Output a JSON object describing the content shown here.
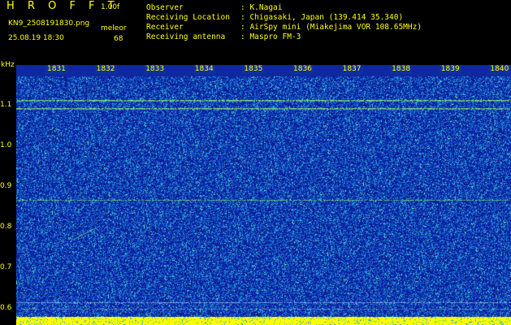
{
  "header": {
    "app_title": "H R O F F T",
    "version": "1.00f",
    "filename": "KN9_2508191830.png",
    "datetime": "25.08.19 18:30",
    "meleor_label": "meleor",
    "meleor_value": "68"
  },
  "info": {
    "labels": [
      "Observer",
      "Receiving Location",
      "Receiver",
      "Receiving antenna"
    ],
    "values": [
      ": K.Nagai",
      ": Chigasaki, Japan (139.414 35.340)",
      ": AirSpy mini (Miakejima VOR 108.65MHz)",
      ": Maspro FM-3"
    ]
  },
  "axes": {
    "freq_unit": "kHz",
    "freq_ticks": [
      "1.1",
      "1.0",
      "0.9",
      "0.8",
      "0.7",
      "0.6"
    ],
    "time_ticks": [
      "1831",
      "1832",
      "1833",
      "1834",
      "1835",
      "1836",
      "1837",
      "1838",
      "1839",
      "1840"
    ]
  },
  "colors": {
    "background": "#000000",
    "text": "#ffff00",
    "noise_low": "#0b1fa0",
    "noise_high": "#2aa8c8",
    "signal": "#7cf06a",
    "floor": "#ffff00"
  }
}
